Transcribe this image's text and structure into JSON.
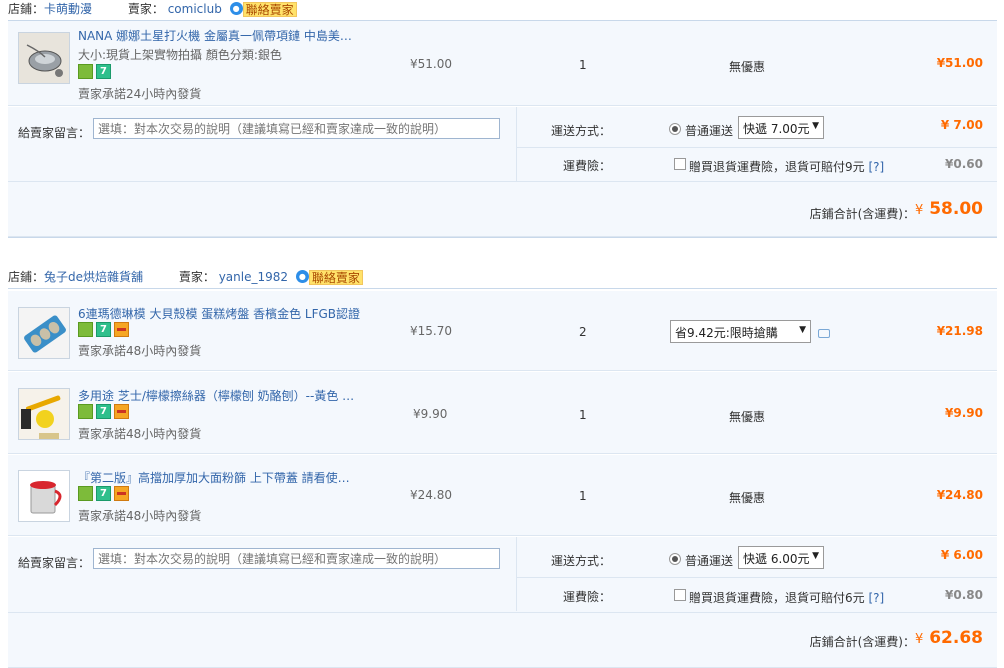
{
  "shops": [
    {
      "shop_label": "店鋪：",
      "shop_name": "卡萌動漫",
      "seller_label": "賣家：",
      "seller_name": "comiclub",
      "chat_label": "聯絡賣家",
      "items": [
        {
          "title": "NANA 娜娜土星打火機 金屬真一佩帶項鏈 中島美…",
          "spec": "大小:現貨上架實物拍攝   顏色分類:銀色",
          "promise": "賣家承諾24小時內發貨",
          "price": "¥51.00",
          "qty": "1",
          "discount": "無優惠",
          "subtotal": "¥51.00"
        }
      ],
      "message_label": "給賣家留言：",
      "message_placeholder": "選填：對本次交易的說明（建議填寫已經和賣家達成一致的說明）",
      "shipping_label": "運送方式：",
      "shipping_option": "普通運送",
      "shipping_select": "快遞 7.00元",
      "shipping_price": "¥ 7.00",
      "insurance_label": "運費險：",
      "insurance_text": "贈買退貨運費險，退貨可賠付9元",
      "insurance_help": "[?]",
      "insurance_price": "¥0.60",
      "total_label": "店鋪合計(含運費)：",
      "total_value": "58.00"
    },
    {
      "shop_label": "店鋪：",
      "shop_name": "兔子de烘焙雜貨舖",
      "seller_label": "賣家：",
      "seller_name": "yanle_1982",
      "chat_label": "聯絡賣家",
      "items": [
        {
          "title": "6連瑪德琳模 大貝殼模 蛋糕烤盤 香檳金色 LFGB認證",
          "promise": "賣家承諾48小時內發貨",
          "price": "¥15.70",
          "qty": "2",
          "discount_select": "省9.42元:限時搶購",
          "subtotal": "¥21.98"
        },
        {
          "title": "多用途 芝士/檸檬擦絲器（檸檬刨 奶酪刨）--黃色 …",
          "promise": "賣家承諾48小時內發貨",
          "price": "¥9.90",
          "qty": "1",
          "discount": "無優惠",
          "subtotal": "¥9.90"
        },
        {
          "title": "『第二版』高擋加厚加大面粉篩 上下帶蓋 請看使…",
          "promise": "賣家承諾48小時內發貨",
          "price": "¥24.80",
          "qty": "1",
          "discount": "無優惠",
          "subtotal": "¥24.80"
        }
      ],
      "message_label": "給賣家留言：",
      "message_placeholder": "選填：對本次交易的說明（建議填寫已經和賣家達成一致的說明）",
      "shipping_label": "運送方式：",
      "shipping_option": "普通運送",
      "shipping_select": "快遞 6.00元",
      "shipping_price": "¥ 6.00",
      "insurance_label": "運費險：",
      "insurance_text": "贈買退貨運費險，退貨可賠付6元",
      "insurance_help": "[?]",
      "insurance_price": "¥0.80",
      "total_label": "店鋪合計(含運費)：",
      "total_value": "62.68"
    }
  ],
  "currency_symbol": "¥",
  "colors": {
    "accent_orange": "#ff6a00",
    "link_blue": "#3366aa",
    "row_bg": "#f4f8fd"
  },
  "icons": [
    "lighter-thumb",
    "madeleine-mold-thumb",
    "grater-thumb",
    "flour-sifter-thumb",
    "chat-icon"
  ]
}
